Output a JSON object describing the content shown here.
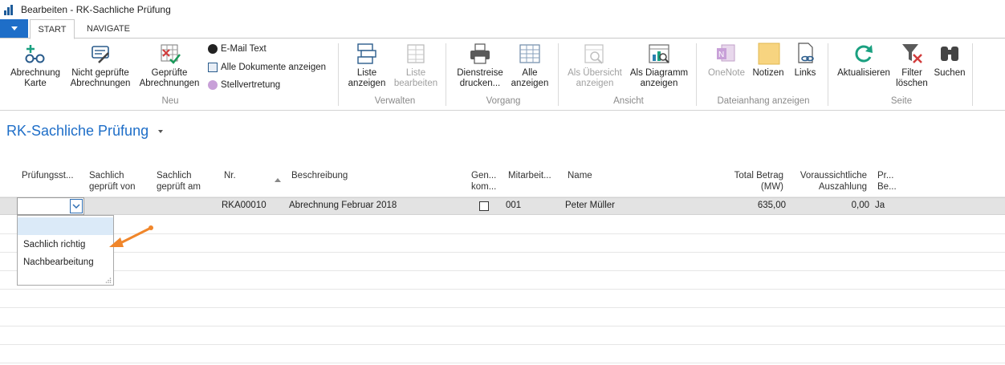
{
  "window": {
    "title": "Bearbeiten - RK-Sachliche Prüfung"
  },
  "tabs": [
    {
      "label": "START"
    },
    {
      "label": "NAVIGATE"
    }
  ],
  "ribbon": {
    "groups": {
      "neu": "Neu",
      "verwalten": "Verwalten",
      "vorgang": "Vorgang",
      "ansicht": "Ansicht",
      "dateianhang": "Dateianhang anzeigen",
      "seite": "Seite"
    },
    "buttons": {
      "abrechnung_karte": [
        "Abrechnung",
        "Karte"
      ],
      "nicht_gepruefte": [
        "Nicht geprüfte",
        "Abrechnungen"
      ],
      "gepruefte": [
        "Geprüfte",
        "Abrechnungen"
      ],
      "email_text": "E-Mail Text",
      "alle_dokumente": "Alle Dokumente anzeigen",
      "stellvertretung": "Stellvertretung",
      "liste_anzeigen": [
        "Liste",
        "anzeigen"
      ],
      "liste_bearbeiten": [
        "Liste",
        "bearbeiten"
      ],
      "dienstreise": [
        "Dienstreise",
        "drucken..."
      ],
      "alle_anzeigen": [
        "Alle",
        "anzeigen"
      ],
      "als_uebersicht": [
        "Als Übersicht",
        "anzeigen"
      ],
      "als_diagramm": [
        "Als Diagramm",
        "anzeigen"
      ],
      "onenote": "OneNote",
      "notizen": "Notizen",
      "links": "Links",
      "aktualisieren": "Aktualisieren",
      "filter_loeschen": [
        "Filter",
        "löschen"
      ],
      "suchen": "Suchen"
    }
  },
  "page": {
    "title": "RK-Sachliche Prüfung"
  },
  "table": {
    "columns": {
      "pruefungsstatus": "Prüfungsst...",
      "sachlich_von": [
        "Sachlich",
        "geprüft von"
      ],
      "sachlich_am": [
        "Sachlich",
        "geprüft am"
      ],
      "nr": "Nr.",
      "beschreibung": "Beschreibung",
      "gen": [
        "Gen...",
        "kom..."
      ],
      "mitarbeiter": "Mitarbeit...",
      "name": "Name",
      "total_betrag": [
        "Total Betrag",
        "(MW)"
      ],
      "voraussichtliche": [
        "Voraussichtliche",
        "Auszahlung"
      ],
      "pr": [
        "Pr...",
        "Be..."
      ]
    },
    "rows": [
      {
        "nr": "RKA00010",
        "beschreibung": "Abrechnung Februar 2018",
        "mitarbeiter": "001",
        "name": "Peter Müller",
        "total_betrag": "635,00",
        "auszahlung": "0,00",
        "pr": "Ja"
      }
    ]
  },
  "dropdown": {
    "options": [
      "",
      "Sachlich richtig",
      "Nachbearbeitung"
    ]
  },
  "colors": {
    "accent": "#1e6ec8",
    "annotation_arrow": "#f0862b",
    "selected_row": "#e3e3e3",
    "highlight_option": "#dbeaf8"
  }
}
